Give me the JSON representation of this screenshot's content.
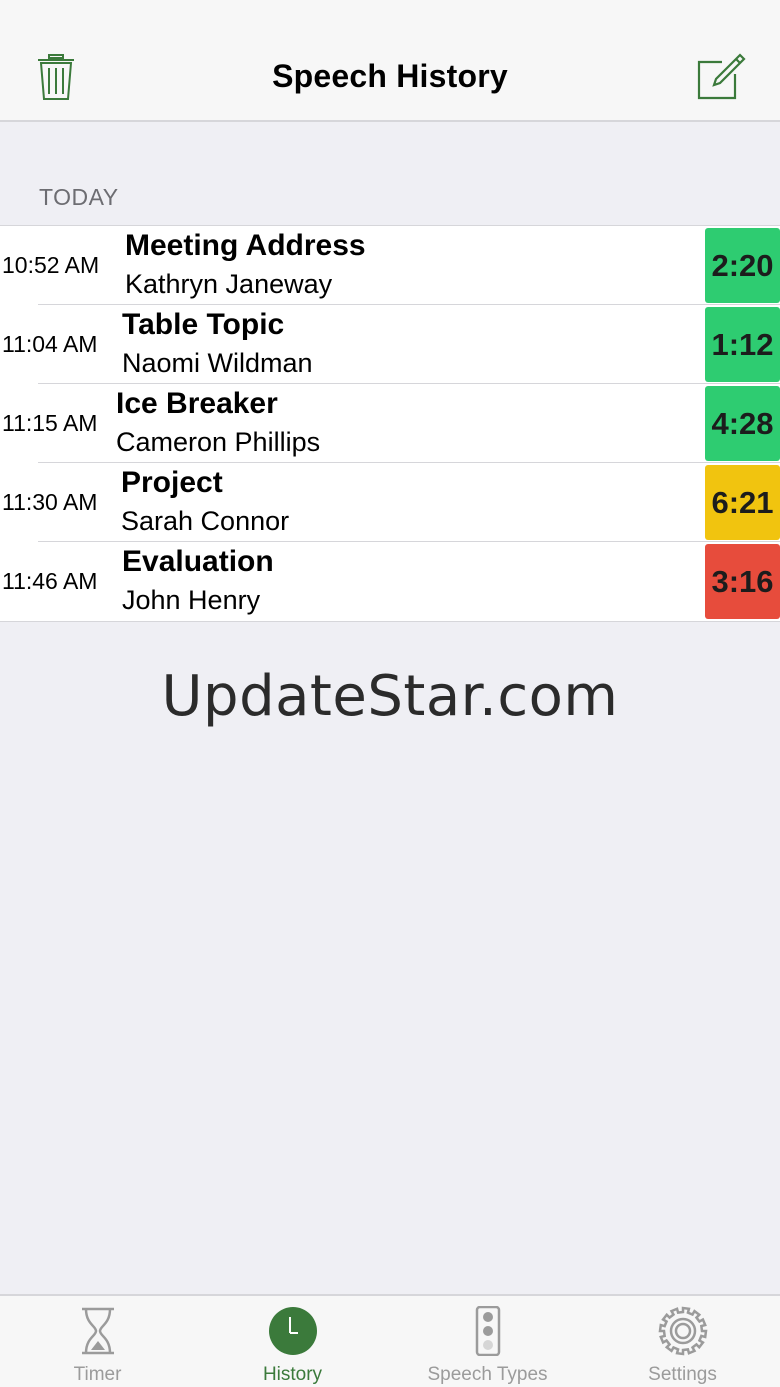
{
  "nav": {
    "title": "Speech History"
  },
  "section": {
    "header": "TODAY"
  },
  "rows": [
    {
      "time": "10:52 AM",
      "title": "Meeting Address",
      "name": "Kathryn Janeway",
      "duration": "2:20",
      "status_color": "#2ecc71"
    },
    {
      "time": "11:04 AM",
      "title": "Table Topic",
      "name": "Naomi Wildman",
      "duration": "1:12",
      "status_color": "#2ecc71"
    },
    {
      "time": "11:15 AM",
      "title": "Ice Breaker",
      "name": "Cameron Phillips",
      "duration": "4:28",
      "status_color": "#2ecc71"
    },
    {
      "time": "11:30 AM",
      "title": "Project",
      "name": "Sarah Connor",
      "duration": "6:21",
      "status_color": "#f1c40f"
    },
    {
      "time": "11:46 AM",
      "title": "Evaluation",
      "name": "John Henry",
      "duration": "3:16",
      "status_color": "#e74c3c"
    }
  ],
  "watermark": "UpdateStar.com",
  "tabs": [
    {
      "label": "Timer",
      "icon": "hourglass-icon",
      "active": false
    },
    {
      "label": "History",
      "icon": "clock-icon",
      "active": true
    },
    {
      "label": "Speech Types",
      "icon": "traffic-light-icon",
      "active": false
    },
    {
      "label": "Settings",
      "icon": "gear-icon",
      "active": false
    }
  ],
  "colors": {
    "accent": "#3b7a3b",
    "inactive": "#9b9b9b"
  }
}
